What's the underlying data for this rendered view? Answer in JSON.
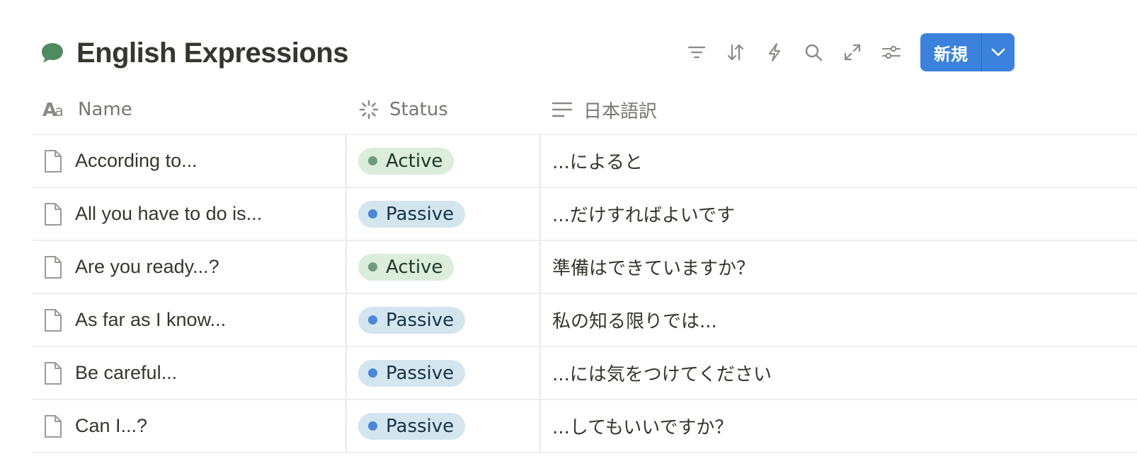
{
  "database": {
    "title": "English Expressions",
    "icon": "speech-bubble-icon",
    "icon_color": "#4f8b60"
  },
  "toolbar": {
    "icons": [
      "filter-icon",
      "sort-icon",
      "automation-icon",
      "search-icon",
      "expand-icon",
      "settings-icon"
    ],
    "new_label": "新規",
    "new_color": "#3b82dc"
  },
  "columns": {
    "name": {
      "label": "Name",
      "icon": "text-property-icon"
    },
    "status": {
      "label": "Status",
      "icon": "status-property-icon"
    },
    "jp": {
      "label": "日本語訳",
      "icon": "long-text-property-icon"
    }
  },
  "status_styles": {
    "Active": {
      "bg": "#dbeddb",
      "dot": "#6c9b7d",
      "text": "#1c3829"
    },
    "Passive": {
      "bg": "#d3e5ef",
      "dot": "#4a88d8",
      "text": "#183347"
    }
  },
  "rows": [
    {
      "name": "According to...",
      "status": "Active",
      "jp": "...によると"
    },
    {
      "name": "All you have to do is...",
      "status": "Passive",
      "jp": "...だけすればよいです"
    },
    {
      "name": "Are you ready...?",
      "status": "Active",
      "jp": "準備はできていますか？"
    },
    {
      "name": "As far as I know...",
      "status": "Passive",
      "jp": "私の知る限りでは..."
    },
    {
      "name": "Be careful...",
      "status": "Passive",
      "jp": "...には気をつけてください"
    },
    {
      "name": "Can I...?",
      "status": "Passive",
      "jp": "...してもいいですか？"
    }
  ]
}
